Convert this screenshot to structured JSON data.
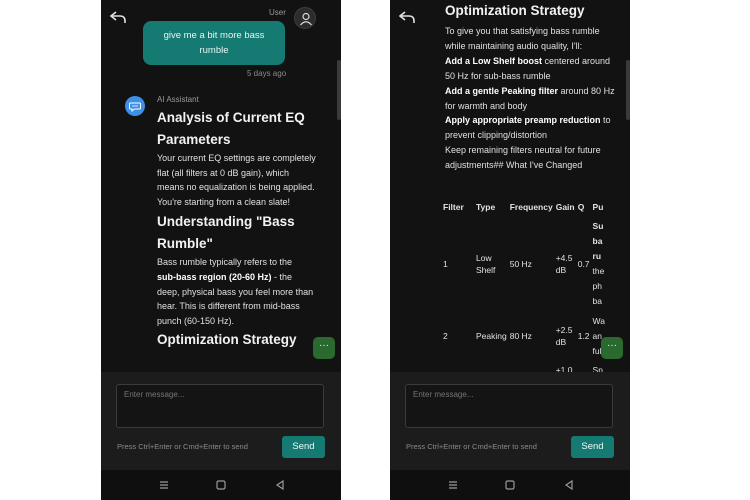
{
  "left": {
    "user_label": "User",
    "user_message": "give me a bit more bass rumble",
    "timestamp": "5 days ago",
    "ai_label": "AI Assistant",
    "h_analysis": "Analysis of Current EQ Parameters",
    "p_analysis": "Your current EQ settings are completely flat (all filters at 0 dB gain), which means no equalization is being applied. You're starting from a clean slate!",
    "h_understanding": "Understanding \"Bass Rumble\"",
    "p_rumble_1": "Bass rumble typically refers to the",
    "p_rumble_bold": "sub-bass region (20-60 Hz)",
    "p_rumble_2": " - the deep, physical bass you feel more than hear. This is different from mid-bass punch (60-150 Hz).",
    "h_strategy": "Optimization Strategy"
  },
  "right": {
    "h_strategy": "Optimization Strategy",
    "intro": "To give you that satisfying bass rumble while maintaining audio quality, I'll:",
    "s1_bold": "Add a Low Shelf boost",
    "s1_rest": " centered around 50 Hz for sub-bass rumble",
    "s2_bold": "Add a gentle Peaking filter",
    "s2_rest": " around 80 Hz for warmth and body",
    "s3_bold": "Apply appropriate preamp reduction",
    "s3_rest": " to prevent clipping/distortion",
    "s4": "Keep remaining filters neutral for future adjustments## What I've Changed",
    "table": {
      "headers": [
        "Filter",
        "Type",
        "Frequency",
        "Gain",
        "Q",
        "Pu"
      ],
      "rows": [
        {
          "filter": "1",
          "type": "Low Shelf",
          "freq": "50 Hz",
          "gain": "+4.5 dB",
          "q": "0.7",
          "purpose": [
            "Su",
            "ba",
            "ru",
            "the",
            "ph",
            "ba"
          ]
        },
        {
          "filter": "2",
          "type": "Peaking",
          "freq": "80 Hz",
          "gain": "+2.5 dB",
          "q": "1.2",
          "purpose": [
            "Wa",
            "an",
            "ful"
          ]
        },
        {
          "filter": "",
          "type": "",
          "freq": "",
          "gain": "+1.0",
          "q": "",
          "purpose": [
            "Sn"
          ]
        }
      ]
    }
  },
  "composer": {
    "placeholder": "Enter message...",
    "hint": "Press Ctrl+Enter or Cmd+Enter to send",
    "send_label": "Send"
  },
  "fab_label": "···",
  "colors": {
    "background": "#121212",
    "user_bubble": "#157a71",
    "send_button": "#157a71",
    "ai_avatar": "#3e8fe6",
    "fab": "#2a6a2f"
  },
  "icons": [
    "back-arrow-icon",
    "user-avatar-icon",
    "ai-assistant-icon",
    "more-icon",
    "nav-menu-icon",
    "nav-home-icon",
    "nav-back-icon"
  ]
}
